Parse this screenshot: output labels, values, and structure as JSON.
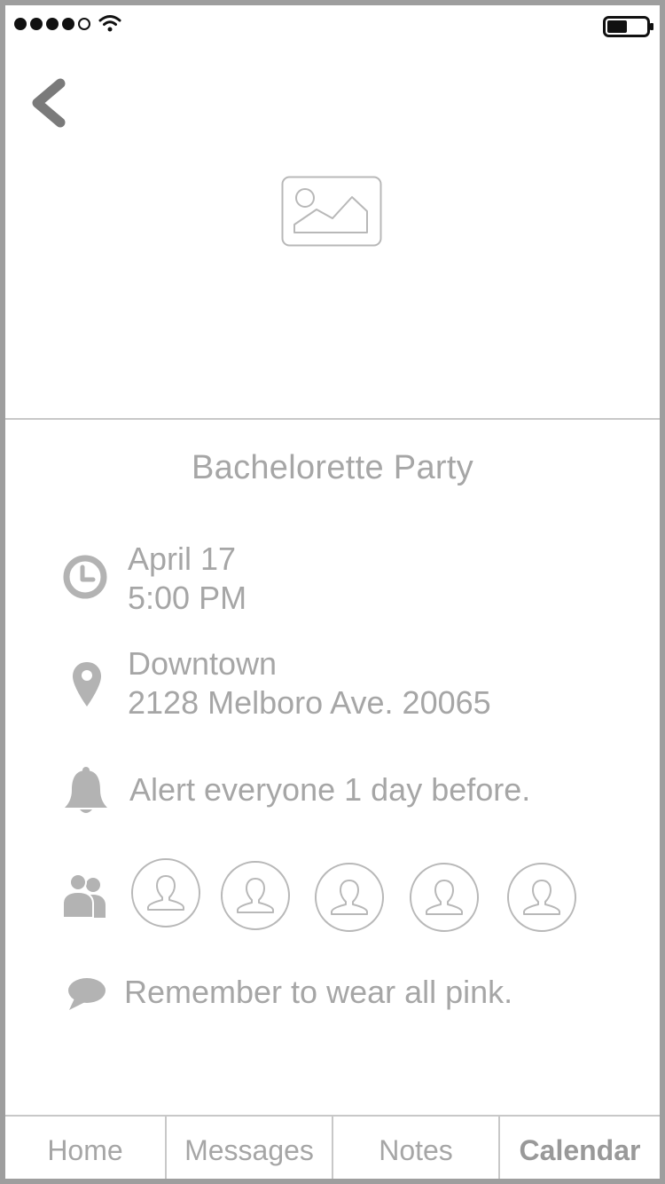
{
  "status_bar": {
    "signal_icon": "signal-dots-icon",
    "wifi_icon": "wifi-icon",
    "battery_icon": "battery-icon"
  },
  "header": {
    "back_icon": "chevron-left-icon",
    "hero_image_icon": "image-placeholder-icon"
  },
  "event": {
    "title": "Bachelorette Party",
    "date": "April 17",
    "time": "5:00 PM",
    "location_name": "Downtown",
    "address": "2128 Melboro Ave. 20065",
    "alert": "Alert everyone 1 day before.",
    "note": "Remember to wear all pink.",
    "attendee_count": 5
  },
  "icons": {
    "time": "clock-icon",
    "location": "map-pin-icon",
    "alert": "bell-icon",
    "attendees": "group-icon",
    "note": "speech-bubble-icon",
    "avatar": "user-avatar-icon"
  },
  "tab_bar": {
    "tabs": [
      {
        "label": "Home"
      },
      {
        "label": "Messages"
      },
      {
        "label": "Notes"
      },
      {
        "label": "Calendar"
      }
    ],
    "active": "Calendar"
  },
  "colors": {
    "text": "#a6a6a6",
    "icon": "#b3b3b3",
    "frame": "#9e9e9e",
    "divider": "#c8c8c8"
  }
}
